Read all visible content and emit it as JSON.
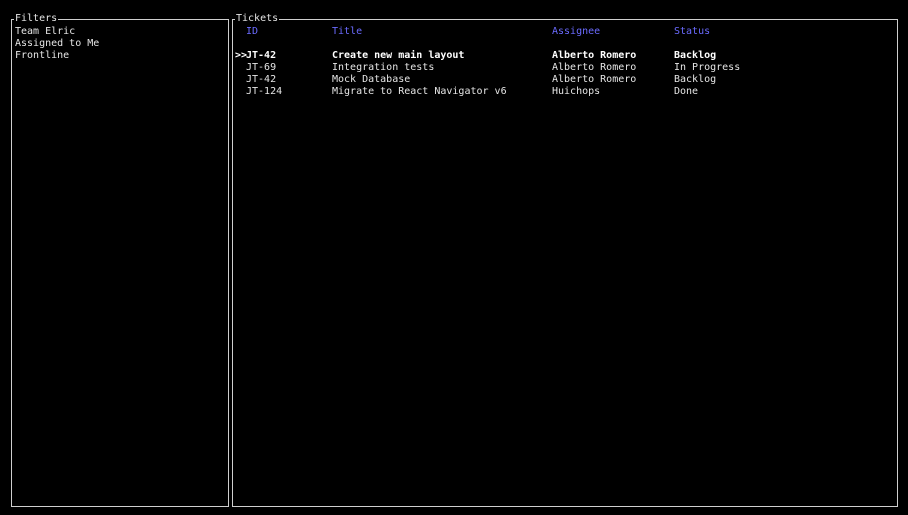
{
  "filters": {
    "title": "Filters",
    "items": [
      "Team Elric",
      "Assigned to Me",
      "Frontline"
    ]
  },
  "tickets": {
    "title": "Tickets",
    "columns": {
      "id": "ID",
      "title": "Title",
      "assignee": "Assignee",
      "status": "Status"
    },
    "cursor": ">>",
    "rows": [
      {
        "id": "JT-42",
        "title": "Create new main layout",
        "assignee": "Alberto Romero",
        "status": "Backlog"
      },
      {
        "id": "JT-69",
        "title": "Integration tests",
        "assignee": "Alberto Romero",
        "status": "In Progress"
      },
      {
        "id": "JT-42",
        "title": "Mock Database",
        "assignee": "Alberto Romero",
        "status": "Backlog"
      },
      {
        "id": "JT-124",
        "title": "Migrate to React Navigator v6",
        "assignee": "Huichops",
        "status": "Done"
      }
    ]
  },
  "colors": {
    "header": "#6b6bff",
    "border": "#cfcfcf",
    "background": "#000000"
  }
}
